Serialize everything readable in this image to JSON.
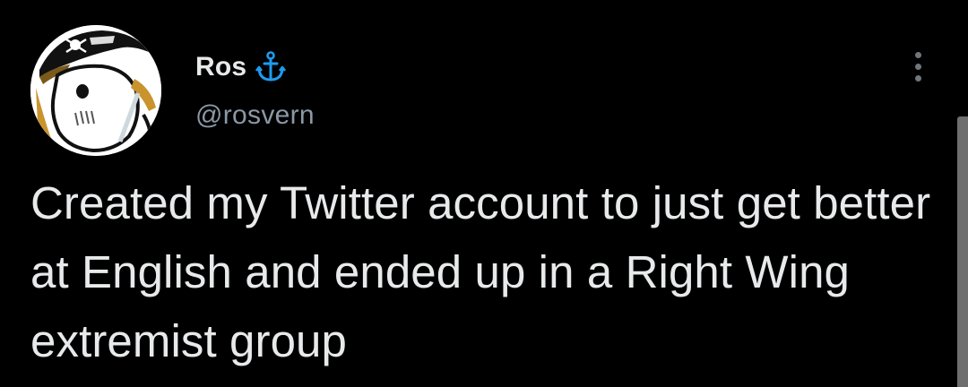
{
  "tweet": {
    "author": {
      "display_name": "Ros",
      "handle": "@rosvern",
      "badge_icon": "anchor-icon",
      "avatar_icon": "pirate-ghost-avatar"
    },
    "text": "Created my Twitter account to just get better at English and ended up in a Right Wing extremist group",
    "more_icon": "more-vertical-icon"
  },
  "colors": {
    "background": "#000000",
    "text_primary": "#e7e9ea",
    "text_secondary": "#8b98a5",
    "accent_anchor": "#1d9bf0"
  }
}
